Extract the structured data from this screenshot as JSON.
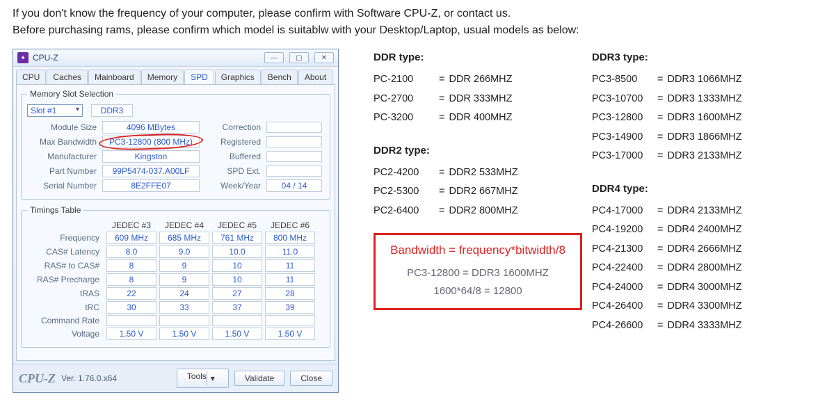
{
  "intro": {
    "line1": "If you don't know the frequency of your computer, please confirm with Software CPU-Z, or contact us.",
    "line2": "Before purchasing rams, please confirm which model is suitablw with your Desktop/Laptop, usual models as below:"
  },
  "cpuz": {
    "title": "CPU-Z",
    "tabs": [
      "CPU",
      "Caches",
      "Mainboard",
      "Memory",
      "SPD",
      "Graphics",
      "Bench",
      "About"
    ],
    "slot": {
      "legend": "Memory Slot Selection",
      "slot_label": "Slot #1",
      "ddr": "DDR3",
      "labels": {
        "module_size": "Module Size",
        "max_bw": "Max Bandwidth",
        "manufacturer": "Manufacturer",
        "part_number": "Part Number",
        "serial": "Serial Number",
        "correction": "Correction",
        "registered": "Registered",
        "buffered": "Buffered",
        "spdext": "SPD Ext.",
        "weekyear": "Week/Year"
      },
      "values": {
        "module_size": "4096 MBytes",
        "max_bw": "PC3-12800 (800 MHz)",
        "manufacturer": "Kingston",
        "part_number": "99P5474-037.A00LF",
        "serial": "8E2FFE07",
        "weekyear": "04 / 14"
      }
    },
    "timings": {
      "legend": "Timings Table",
      "headers": [
        "JEDEC #3",
        "JEDEC #4",
        "JEDEC #5",
        "JEDEC #6"
      ],
      "rows": [
        {
          "label": "Frequency",
          "vals": [
            "609 MHz",
            "685 MHz",
            "761 MHz",
            "800 MHz"
          ]
        },
        {
          "label": "CAS# Latency",
          "vals": [
            "8.0",
            "9.0",
            "10.0",
            "11.0"
          ]
        },
        {
          "label": "RAS# to CAS#",
          "vals": [
            "8",
            "9",
            "10",
            "11"
          ]
        },
        {
          "label": "RAS# Precharge",
          "vals": [
            "8",
            "9",
            "10",
            "11"
          ]
        },
        {
          "label": "tRAS",
          "vals": [
            "22",
            "24",
            "27",
            "28"
          ]
        },
        {
          "label": "tRC",
          "vals": [
            "30",
            "33",
            "37",
            "39"
          ]
        },
        {
          "label": "Command Rate",
          "vals": [
            "",
            "",
            "",
            ""
          ]
        },
        {
          "label": "Voltage",
          "vals": [
            "1.50 V",
            "1.50 V",
            "1.50 V",
            "1.50 V"
          ]
        }
      ]
    },
    "footer": {
      "brand": "CPU-Z",
      "ver": "Ver. 1.76.0.x64",
      "tools": "Tools",
      "validate": "Validate",
      "close": "Close"
    }
  },
  "specs": {
    "ddr": {
      "title": "DDR type:",
      "rows": [
        [
          "PC-2100",
          "DDR 266MHZ"
        ],
        [
          "PC-2700",
          "DDR 333MHZ"
        ],
        [
          "PC-3200",
          "DDR 400MHZ"
        ]
      ]
    },
    "ddr2": {
      "title": "DDR2 type:",
      "rows": [
        [
          "PC2-4200",
          "DDR2 533MHZ"
        ],
        [
          "PC2-5300",
          "DDR2 667MHZ"
        ],
        [
          "PC2-6400",
          "DDR2 800MHZ"
        ]
      ]
    },
    "ddr3": {
      "title": "DDR3 type:",
      "rows": [
        [
          "PC3-8500",
          "DDR3 1066MHZ"
        ],
        [
          "PC3-10700",
          "DDR3 1333MHZ"
        ],
        [
          "PC3-12800",
          "DDR3 1600MHZ"
        ],
        [
          "PC3-14900",
          "DDR3 1866MHZ"
        ],
        [
          "PC3-17000",
          "DDR3 2133MHZ"
        ]
      ]
    },
    "ddr4": {
      "title": "DDR4 type:",
      "rows": [
        [
          "PC4-17000",
          "DDR4 2133MHZ"
        ],
        [
          "PC4-19200",
          "DDR4 2400MHZ"
        ],
        [
          "PC4-21300",
          "DDR4 2666MHZ"
        ],
        [
          "PC4-22400",
          "DDR4 2800MHZ"
        ],
        [
          "PC4-24000",
          "DDR4 3000MHZ"
        ],
        [
          "PC4-26400",
          "DDR4 3300MHZ"
        ],
        [
          "PC4-26600",
          "DDR4 3333MHZ"
        ]
      ]
    },
    "formula": {
      "f1": "Bandwidth = frequency*bitwidth/8",
      "f2": "PC3-12800 = DDR3 1600MHZ",
      "f3": "1600*64/8 = 12800"
    }
  }
}
